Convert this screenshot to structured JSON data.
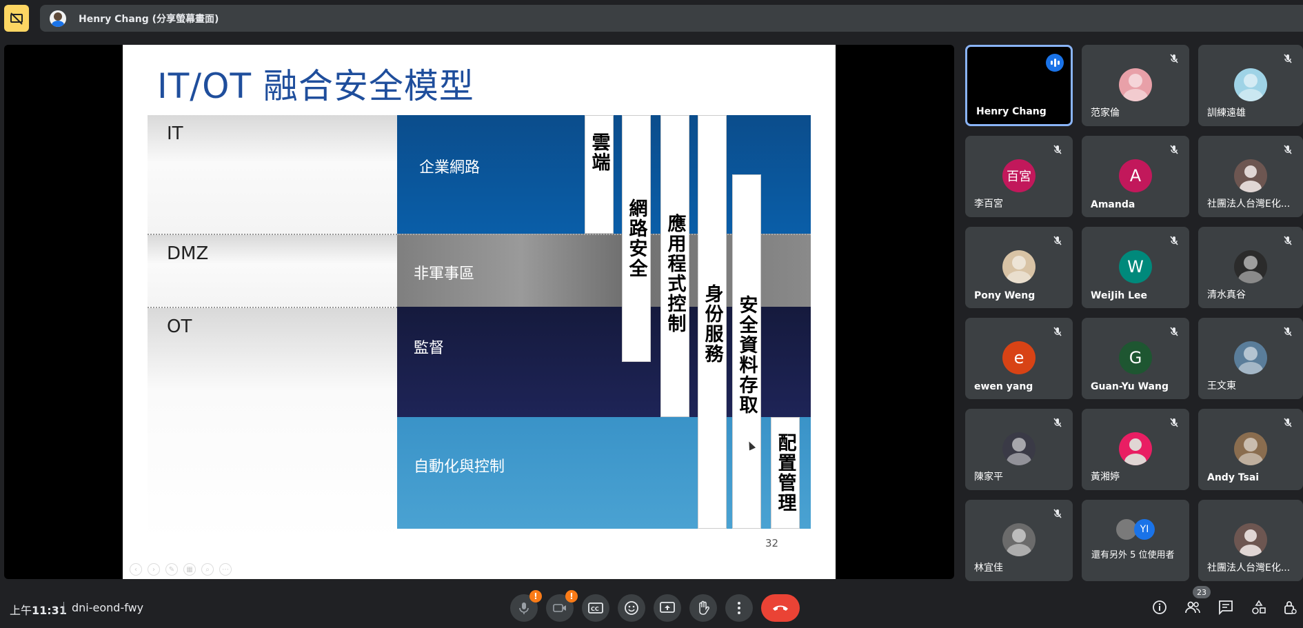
{
  "window": {
    "presenter_label": "Henry Chang (分享螢幕畫面)"
  },
  "slide": {
    "title": "IT/OT 融合安全模型",
    "zones": [
      "IT",
      "DMZ",
      "OT"
    ],
    "bands": [
      "企業網路",
      "非軍事區",
      "監督",
      "自動化與控制"
    ],
    "columns": [
      "雲端",
      "網路安全",
      "應用程式控制",
      "身份服務",
      "安全資料存取",
      "配置管理"
    ],
    "page_number": "32"
  },
  "participants": [
    {
      "name": "Henry Chang",
      "state": "speaking",
      "avatar": "none"
    },
    {
      "name": "范家倫",
      "state": "muted",
      "avatar": "photo",
      "color": "#e8a0a8"
    },
    {
      "name": "訓練遠雄",
      "state": "muted",
      "avatar": "photo",
      "color": "#9fd3e6"
    },
    {
      "name": "李百宮",
      "state": "muted",
      "avatar": "initial",
      "initial": "百宮",
      "color": "#c2185b"
    },
    {
      "name": "Amanda",
      "state": "muted",
      "avatar": "initial",
      "initial": "A",
      "color": "#c2185b"
    },
    {
      "name": "社團法人台灣E化...",
      "state": "muted",
      "avatar": "person"
    },
    {
      "name": "Pony Weng",
      "state": "muted",
      "avatar": "photo",
      "color": "#d8c3a5"
    },
    {
      "name": "WeiJih Lee",
      "state": "muted",
      "avatar": "initial",
      "initial": "W",
      "color": "#00897b"
    },
    {
      "name": "清水真谷",
      "state": "muted",
      "avatar": "photo",
      "color": "#2b2b2b"
    },
    {
      "name": "ewen yang",
      "state": "muted",
      "avatar": "initial",
      "initial": "e",
      "color": "#d84315"
    },
    {
      "name": "Guan-Yu Wang",
      "state": "muted",
      "avatar": "initial",
      "initial": "G",
      "color": "#1e5631"
    },
    {
      "name": "王文東",
      "state": "muted",
      "avatar": "photo",
      "color": "#5a7d9a"
    },
    {
      "name": "陳家平",
      "state": "muted",
      "avatar": "photo",
      "color": "#3a3a46"
    },
    {
      "name": "黃湘婷",
      "state": "muted",
      "avatar": "person_pink",
      "color": "#e91e63"
    },
    {
      "name": "Andy Tsai",
      "state": "muted",
      "avatar": "photo",
      "color": "#8a6d4f"
    },
    {
      "name": "林宜佳",
      "state": "muted",
      "avatar": "photo",
      "color": "#6b6b6b"
    },
    {
      "name": "還有另外 5 位使用者",
      "state": "more",
      "avatar": "pair",
      "initial": "YI",
      "color": "#1a73e8"
    },
    {
      "name": "社團法人台灣E化...",
      "state": "none",
      "avatar": "person"
    }
  ],
  "bottom": {
    "time_prefix": "上午",
    "time": "11:31",
    "meeting_code": "dni-eond-fwy",
    "people_count": "23",
    "warning_mark": "!"
  },
  "icons": {
    "stop": "stop-presenting-icon",
    "mic": "mic-off-icon",
    "cam": "camera-off-icon",
    "cc": "captions-icon",
    "emoji": "emoji-icon",
    "present": "present-icon",
    "hand": "raise-hand-icon",
    "more": "more-vert-icon",
    "hangup": "hangup-icon",
    "info": "info-icon",
    "people": "people-icon",
    "chat": "chat-icon",
    "activities": "activities-icon",
    "lock": "host-controls-icon"
  },
  "colors": {
    "accent": "#8ab4f8",
    "hangup": "#ea4335",
    "warning": "#fa7b17",
    "stop": "#fdd663"
  }
}
